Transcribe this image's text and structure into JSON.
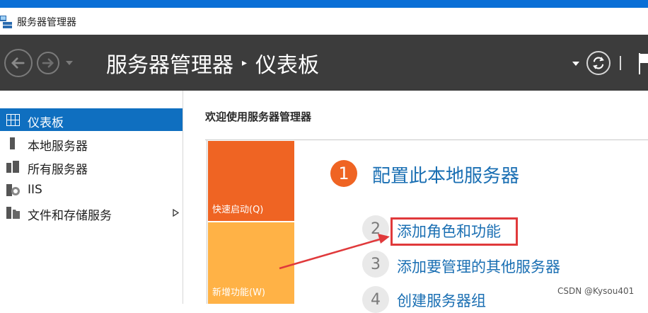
{
  "window": {
    "title": "服务器管理器"
  },
  "header": {
    "breadcrumb_root": "服务器管理器",
    "breadcrumb_current": "仪表板"
  },
  "sidebar": {
    "items": [
      {
        "label": "仪表板",
        "icon": "dashboard-icon",
        "active": true
      },
      {
        "label": "本地服务器",
        "icon": "server-icon"
      },
      {
        "label": "所有服务器",
        "icon": "servers-icon"
      },
      {
        "label": "IIS",
        "icon": "iis-icon"
      },
      {
        "label": "文件和存储服务",
        "icon": "storage-icon",
        "has_children": true
      }
    ]
  },
  "main": {
    "welcome": "欢迎使用服务器管理器",
    "tiles": [
      {
        "label": "快速启动(Q)",
        "color": "#ef6423"
      },
      {
        "label": "新增功能(W)",
        "color": "#ffb246"
      }
    ],
    "steps": [
      {
        "num": "1",
        "text": "配置此本地服务器"
      },
      {
        "num": "2",
        "text": "添加角色和功能"
      },
      {
        "num": "3",
        "text": "添加要管理的其他服务器"
      },
      {
        "num": "4",
        "text": "创建服务器组"
      }
    ],
    "annotation_color": "#e0393b"
  },
  "watermark": "CSDN @Kysou401",
  "colors": {
    "header_bg": "#3c3c3c",
    "accent": "#0f6fc0",
    "link": "#1a6fb3"
  }
}
